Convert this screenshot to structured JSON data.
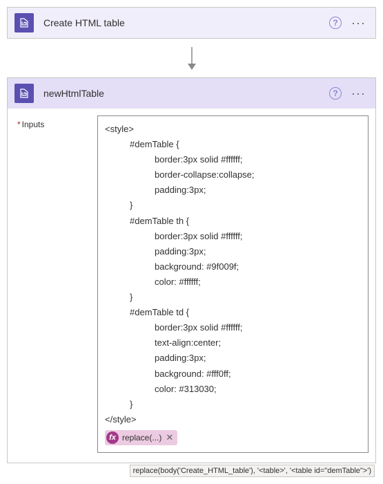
{
  "step1": {
    "title": "Create HTML table",
    "icon": "data-operation-icon"
  },
  "step2": {
    "title": "newHtmlTable",
    "icon": "data-operation-icon",
    "field_label": "Inputs",
    "css_text": {
      "open": "<style>",
      "rule1_sel": "#demTable {",
      "rule1_p1": "border:3px solid #ffffff;",
      "rule1_p2": "border-collapse:collapse;",
      "rule1_p3": "padding:3px;",
      "rule2_sel": "#demTable th {",
      "rule2_p1": "border:3px solid #ffffff;",
      "rule2_p2": "padding:3px;",
      "rule2_p3": "background: #9f009f;",
      "rule2_p4": "color: #ffffff;",
      "rule3_sel": "#demTable td {",
      "rule3_p1": "border:3px solid #ffffff;",
      "rule3_p2": "text-align:center;",
      "rule3_p3": "padding:3px;",
      "rule3_p4": "background: #fff0ff;",
      "rule3_p5": "color: #313030;",
      "brace": "}",
      "close": "</style>"
    },
    "expression_pill": "replace(...)",
    "expression_tooltip": "replace(body('Create_HTML_table'), '<table>', '<table id=\"demTable\">')"
  }
}
